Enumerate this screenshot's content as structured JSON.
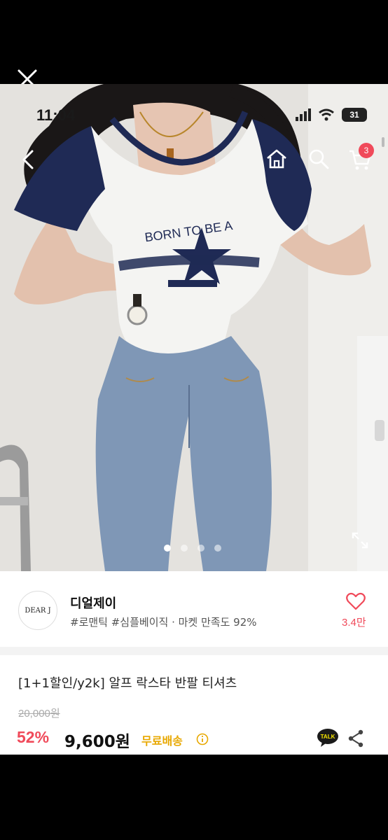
{
  "status_bar": {
    "time": "11:04",
    "battery": "31"
  },
  "nav": {
    "cart_count": "3"
  },
  "carousel": {
    "total": 4,
    "active": 0
  },
  "store": {
    "logo_text": "DEAR J",
    "name": "디얼제이",
    "tags": "#로맨틱 #심플베이직 · 마켓 만족도 92%",
    "likes": "3.4만"
  },
  "product": {
    "title": "[1+1할인/y2k] 알프 락스타 반팔 티셔츠",
    "original_price": "20,000원",
    "discount": "52%",
    "price": "9,600원",
    "shipping": "무료배송",
    "talk_label": "TALK"
  },
  "shirt_print": {
    "text": "BORN TO BE A"
  },
  "colors": {
    "accent": "#f04a5a",
    "shipping": "#e8a800",
    "navy": "#1f2a55"
  },
  "icons": [
    "close-icon",
    "back-icon",
    "home-icon",
    "search-icon",
    "cart-icon",
    "expand-icon",
    "heart-icon",
    "info-icon",
    "talk-icon",
    "share-icon"
  ]
}
